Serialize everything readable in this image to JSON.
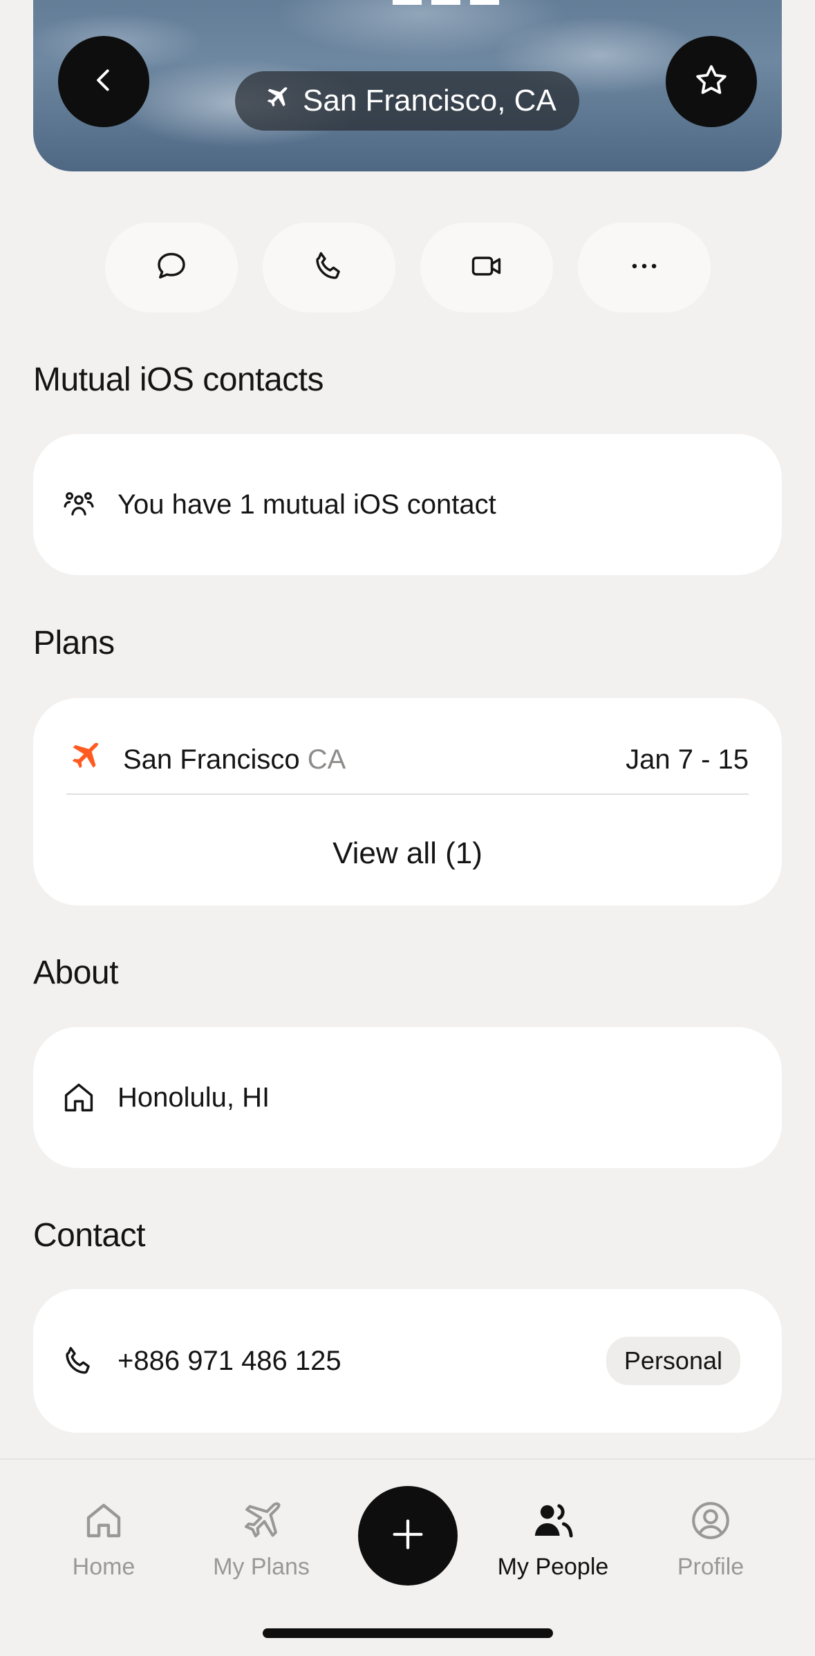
{
  "hero": {
    "location_pill": "San Francisco, CA"
  },
  "action_buttons": [
    "message",
    "call",
    "video",
    "more"
  ],
  "sections": {
    "mutual_title": "Mutual iOS contacts",
    "mutual_text": "You have 1 mutual iOS contact",
    "plans_title": "Plans",
    "plan": {
      "city": "San Francisco",
      "state": "CA",
      "dates": "Jan 7 - 15"
    },
    "view_all": "View all (1)",
    "about_title": "About",
    "about_home": "Honolulu, HI",
    "contact_title": "Contact",
    "phone": "+886 971 486 125",
    "phone_label": "Personal"
  },
  "tabbar": {
    "home": "Home",
    "my_plans": "My Plans",
    "my_people": "My People",
    "profile": "Profile",
    "active": "My People"
  },
  "colors": {
    "accent": "#FF5A1F",
    "background": "#F3F1EF",
    "card": "#FFFFFF",
    "dark": "#0E0E0E"
  }
}
